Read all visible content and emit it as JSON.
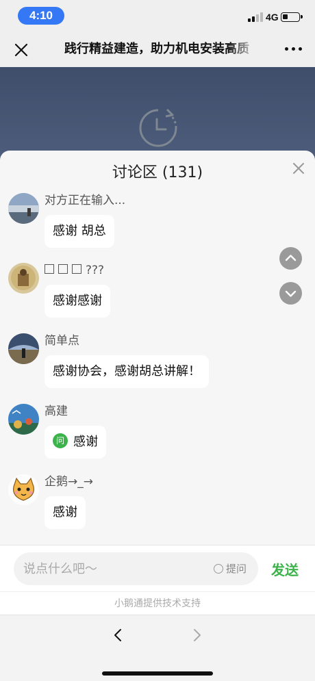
{
  "status_bar": {
    "time": "4:10",
    "network": "4G",
    "battery_level": 0.3
  },
  "nav": {
    "title": "践行精益建造，助力机电安装高质"
  },
  "panel": {
    "title": "讨论区 (131)"
  },
  "messages": [
    {
      "nickname": "对方正在输入...",
      "text": "感谢 胡总"
    },
    {
      "nickname": "???",
      "text": "感谢感谢"
    },
    {
      "nickname": "简单点",
      "text": "感谢协会，感谢胡总讲解！"
    },
    {
      "nickname": "高建",
      "badge": "问",
      "text": "感谢"
    },
    {
      "nickname": "企鹅→_→",
      "text": "感谢"
    }
  ],
  "input": {
    "placeholder": "说点什么吧～",
    "ask_label": "提问",
    "send_label": "发送"
  },
  "footer": {
    "powered_by": "小鹅通提供技术支持"
  },
  "colors": {
    "accent_green": "#3cb34a",
    "time_pill": "#3478f6",
    "video_bg": "#46556f"
  }
}
